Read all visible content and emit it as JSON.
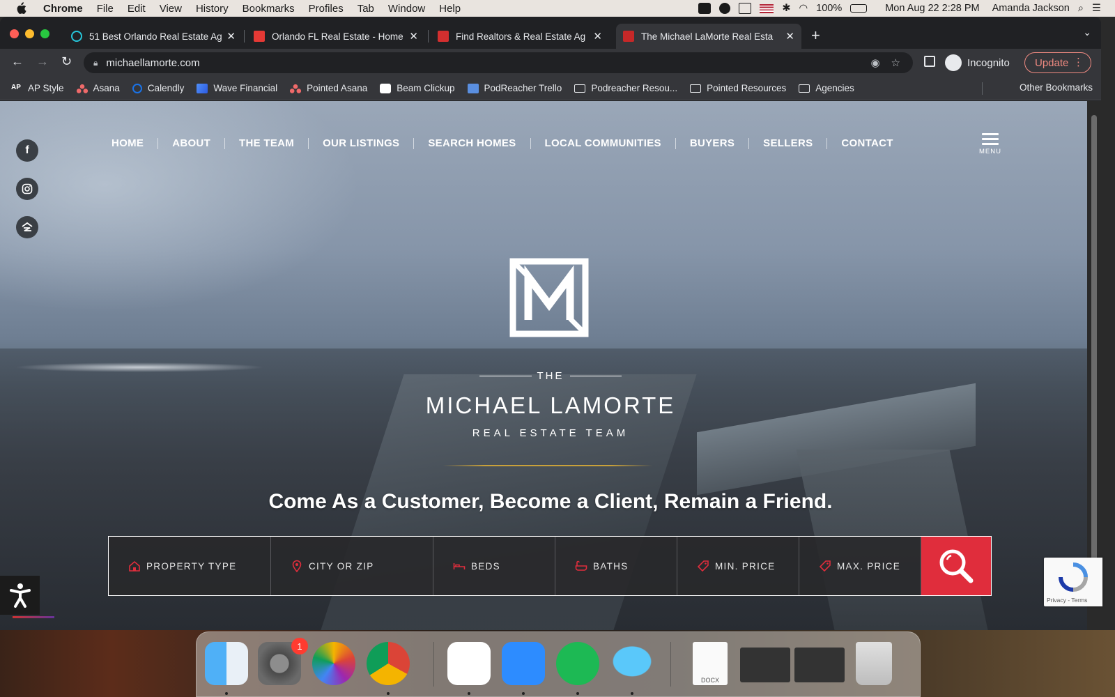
{
  "menubar": {
    "app": "Chrome",
    "items": [
      "File",
      "Edit",
      "View",
      "History",
      "Bookmarks",
      "Profiles",
      "Tab",
      "Window",
      "Help"
    ],
    "battery": "100%",
    "datetime": "Mon Aug 22  2:28 PM",
    "user": "Amanda Jackson"
  },
  "browser": {
    "tabs": [
      {
        "title": "51 Best Orlando Real Estate Ag",
        "favicon_color": "#26c6da"
      },
      {
        "title": "Orlando FL Real Estate - Home",
        "favicon_color": "#e53935"
      },
      {
        "title": "Find Realtors & Real Estate Ag",
        "favicon_color": "#d32f2f"
      },
      {
        "title": "The Michael LaMorte Real Esta",
        "favicon_color": "#c62828"
      }
    ],
    "url": "michaellamorte.com",
    "incognito_label": "Incognito",
    "update_label": "Update",
    "bookmarks": [
      {
        "label": "AP Style",
        "icon": "ap-icon"
      },
      {
        "label": "Asana",
        "icon": "asana-icon"
      },
      {
        "label": "Calendly",
        "icon": "calendly-icon"
      },
      {
        "label": "Wave Financial",
        "icon": "wave-icon"
      },
      {
        "label": "Pointed Asana",
        "icon": "asana-icon"
      },
      {
        "label": "Beam Clickup",
        "icon": "clickup-icon"
      },
      {
        "label": "PodReacher Trello",
        "icon": "trello-icon"
      },
      {
        "label": "Podreacher Resou...",
        "icon": "folder-icon"
      },
      {
        "label": "Pointed Resources",
        "icon": "folder-icon"
      },
      {
        "label": "Agencies",
        "icon": "folder-icon"
      }
    ],
    "other_bookmarks": "Other Bookmarks"
  },
  "site": {
    "nav": [
      "HOME",
      "ABOUT",
      "THE TEAM",
      "OUR LISTINGS",
      "SEARCH HOMES",
      "LOCAL COMMUNITIES",
      "BUYERS",
      "SELLERS",
      "CONTACT"
    ],
    "menu_label": "MENU",
    "logo_the": "THE",
    "logo_name": "MICHAEL LAMORTE",
    "logo_sub": "REAL ESTATE TEAM",
    "tagline": "Come As a Customer, Become a Client, Remain a Friend.",
    "search_fields": [
      {
        "label": "PROPERTY TYPE",
        "icon": "house-icon"
      },
      {
        "label": "CITY OR ZIP",
        "icon": "map-pin-icon"
      },
      {
        "label": "BEDS",
        "icon": "bed-icon"
      },
      {
        "label": "BATHS",
        "icon": "bathtub-icon"
      },
      {
        "label": "MIN. PRICE",
        "icon": "price-tag-icon"
      },
      {
        "label": "MAX. PRICE",
        "icon": "price-tag-icon"
      }
    ],
    "social": [
      "facebook-icon",
      "instagram-icon",
      "zillow-icon"
    ],
    "recaptcha_text": "Privacy - Terms"
  },
  "dock": {
    "badge": "1",
    "docx_label": "DOCX"
  },
  "colors": {
    "accent_red": "#e02d3c",
    "gold": "#c9a13a"
  }
}
